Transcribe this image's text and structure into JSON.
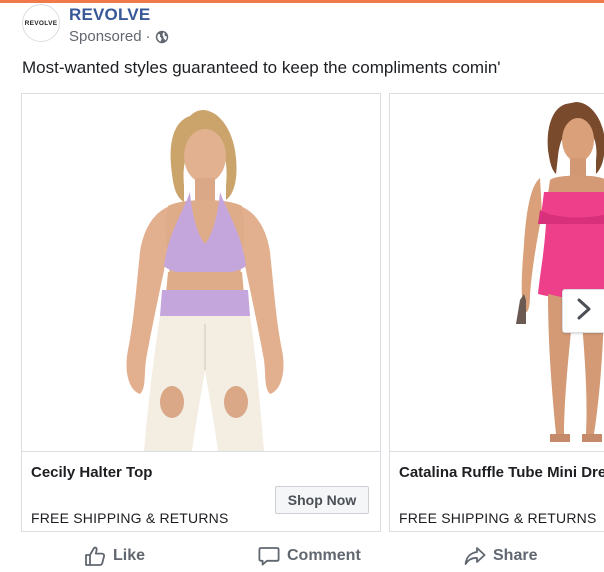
{
  "post": {
    "avatar_text": "REVOLVE",
    "page_name": "REVOLVE",
    "sponsored_label": "Sponsored",
    "separator": "·",
    "privacy_icon": "globe-icon",
    "message": "Most-wanted styles guaranteed to keep the compliments comin'"
  },
  "carousel": {
    "cards": [
      {
        "title": "Cecily Halter Top",
        "subtitle": "FREE SHIPPING & RETURNS",
        "cta_label": "Shop Now",
        "image_icon": "model-lavender-halter-top-photo"
      },
      {
        "title": "Catalina Ruffle Tube Mini Dress",
        "subtitle": "FREE SHIPPING & RETURNS",
        "image_icon": "model-pink-ruffle-dress-photo"
      }
    ],
    "next_icon": "chevron-right-icon"
  },
  "actions": {
    "like_label": "Like",
    "comment_label": "Comment",
    "share_label": "Share"
  },
  "colors": {
    "brand_link": "#385898",
    "accent_strip": "#f07a4a",
    "secondary_text": "#616770",
    "border": "#dadde1",
    "lavender_top": "#c4a6dc",
    "pink_dress": "#ee3f8b"
  }
}
